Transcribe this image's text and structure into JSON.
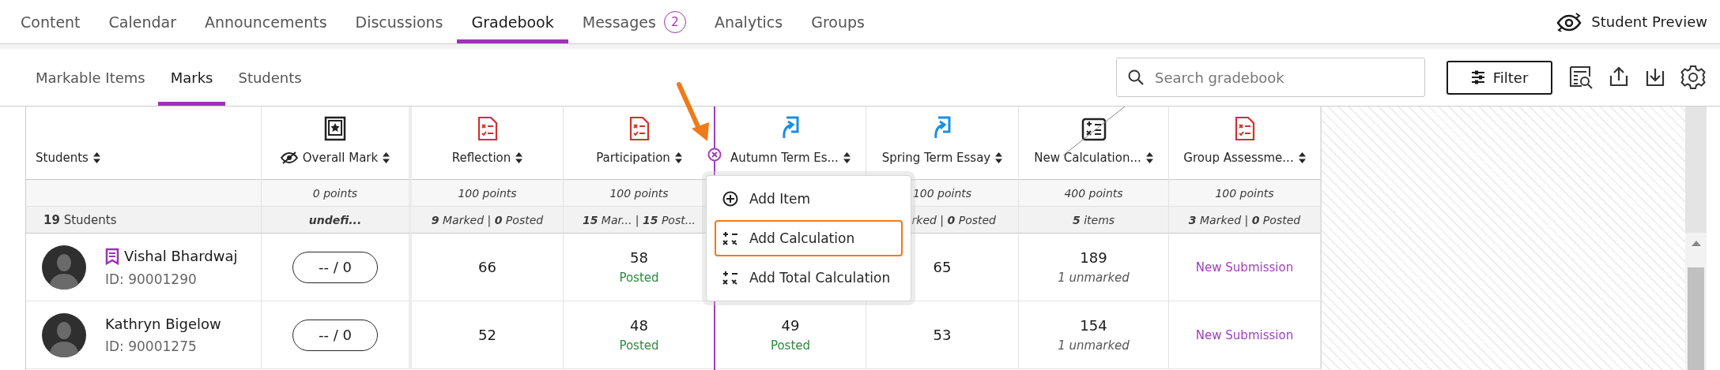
{
  "top_nav": {
    "tabs": [
      {
        "label": "Content",
        "selected": false
      },
      {
        "label": "Calendar",
        "selected": false
      },
      {
        "label": "Announcements",
        "selected": false
      },
      {
        "label": "Discussions",
        "selected": false
      },
      {
        "label": "Gradebook",
        "selected": true
      },
      {
        "label": "Messages",
        "selected": false,
        "badge": "2"
      },
      {
        "label": "Analytics",
        "selected": false
      },
      {
        "label": "Groups",
        "selected": false
      }
    ],
    "student_preview": "Student Preview"
  },
  "sub_tabs": [
    {
      "label": "Markable Items",
      "selected": false
    },
    {
      "label": "Marks",
      "selected": true
    },
    {
      "label": "Students",
      "selected": false
    }
  ],
  "search": {
    "placeholder": "Search gradebook"
  },
  "filter_button": "Filter",
  "table": {
    "columns": [
      {
        "label": "Students",
        "kind": "students",
        "summary": "**19** Students"
      },
      {
        "label": "Overall Mark",
        "kind": "overall",
        "hidden_from_students": true,
        "points": "0 points",
        "summary": "undefi...",
        "summary_bold": true
      },
      {
        "label": "Reflection",
        "kind": "test",
        "points": "100 points",
        "summary": "**9** Marked | **0** Posted"
      },
      {
        "label": "Participation",
        "kind": "test",
        "points": "100 points",
        "summary": "**15** Mar...  | **15** Post..."
      },
      {
        "label": "Autumn Term Es...",
        "kind": "assignment"
      },
      {
        "label": "Spring Term Essay",
        "kind": "assignment",
        "points": "100 points",
        "summary": "rked | **0** Posted",
        "summary_cut": true
      },
      {
        "label": "New Calculation...",
        "kind": "calculation",
        "points": "400 points",
        "summary": "**5** items"
      },
      {
        "label": "Group Assessme...",
        "kind": "test",
        "points": "100 points",
        "summary": "**3** Marked | **0** Posted"
      }
    ],
    "rows": [
      {
        "cells": [
          {
            "kind": "student",
            "name": "Vishal Bhardwaj",
            "id": "ID: 90001290",
            "flagged": true
          },
          {
            "kind": "pill",
            "value": "-- / 0"
          },
          {
            "kind": "score",
            "value": "66"
          },
          {
            "kind": "score",
            "value": "58",
            "note": {
              "kind": "posted",
              "text": "Posted"
            }
          },
          null,
          {
            "kind": "score",
            "value": "65"
          },
          {
            "kind": "score",
            "value": "189",
            "note": {
              "kind": "unmarked",
              "text": "1 unmarked"
            }
          },
          {
            "kind": "link",
            "value": "New Submission"
          }
        ]
      },
      {
        "cells": [
          {
            "kind": "student",
            "name": "Kathryn Bigelow",
            "id": "ID: 90001275",
            "flagged": false
          },
          {
            "kind": "pill",
            "value": "-- / 0"
          },
          {
            "kind": "score",
            "value": "52"
          },
          {
            "kind": "score",
            "value": "48",
            "note": {
              "kind": "posted",
              "text": "Posted"
            }
          },
          {
            "kind": "score",
            "value": "49",
            "note": {
              "kind": "posted",
              "text": "Posted"
            }
          },
          {
            "kind": "score",
            "value": "53"
          },
          {
            "kind": "score",
            "value": "154",
            "note": {
              "kind": "unmarked",
              "text": "1 unmarked"
            }
          },
          {
            "kind": "link",
            "value": "New Submission"
          }
        ]
      }
    ]
  },
  "menu": {
    "items": [
      {
        "label": "Add Item",
        "kind": "add",
        "selected": false
      },
      {
        "label": "Add Calculation",
        "kind": "calc",
        "selected": true
      },
      {
        "label": "Add Total Calculation",
        "kind": "calc",
        "selected": false
      }
    ]
  }
}
